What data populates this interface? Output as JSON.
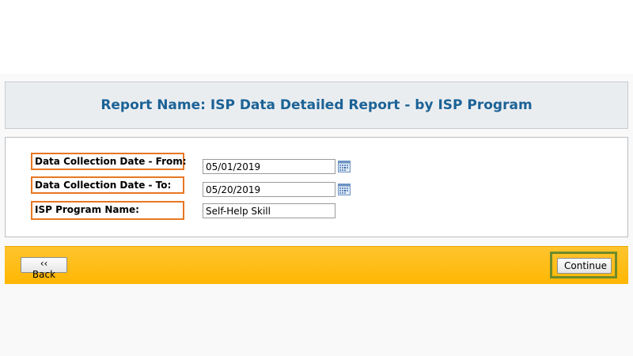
{
  "header": {
    "title": "Report Name: ISP Data Detailed Report - by ISP Program"
  },
  "form": {
    "from_label": "Data Collection Date - From:",
    "from_value": "05/01/2019",
    "to_label": "Data Collection Date - To:",
    "to_value": "05/20/2019",
    "isp_label": "ISP Program Name:",
    "isp_value": "Self-Help Skill"
  },
  "footer": {
    "back_label": "‹‹ Back",
    "continue_label": "Continue"
  },
  "colors": {
    "title": "#1b6296",
    "label_highlight": "#e87722",
    "footer_bar": "#ffbb0f",
    "continue_highlight": "#6e8b2a"
  }
}
